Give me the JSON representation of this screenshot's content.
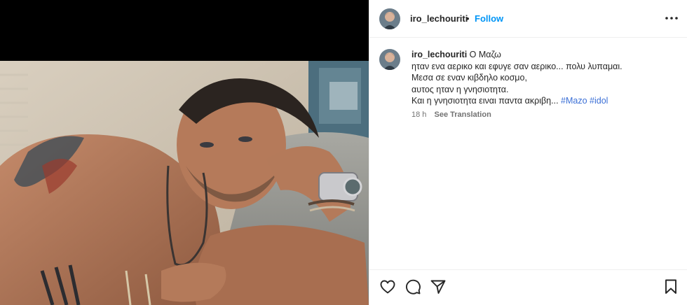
{
  "post": {
    "username": "iro_lechouriti",
    "separator": "•",
    "follow_label": "Follow",
    "more_icon": "more-horizontal-icon"
  },
  "caption": {
    "username": "iro_lechouriti",
    "lines": [
      "Ο Μαζω",
      "ηταν ενα αερικο και εφυγε σαν αερικο... πολυ λυπαμαι.",
      "Μεσα σε εναν κιβδηλο κοσμο,",
      "αυτος ηταν η γνησιοτητα.",
      "Και η γνησιοτητα ειναι παντα ακριβη..."
    ],
    "hashtags": [
      "#Mazo",
      "#idol"
    ],
    "time": "18 h",
    "translate_label": "See Translation"
  },
  "actions": {
    "like_icon": "heart-icon",
    "comment_icon": "comment-icon",
    "share_icon": "send-icon",
    "save_icon": "bookmark-icon"
  },
  "colors": {
    "link": "#0095f6",
    "hashtag": "#3b6fd6",
    "text": "#262626",
    "muted": "#737373"
  }
}
